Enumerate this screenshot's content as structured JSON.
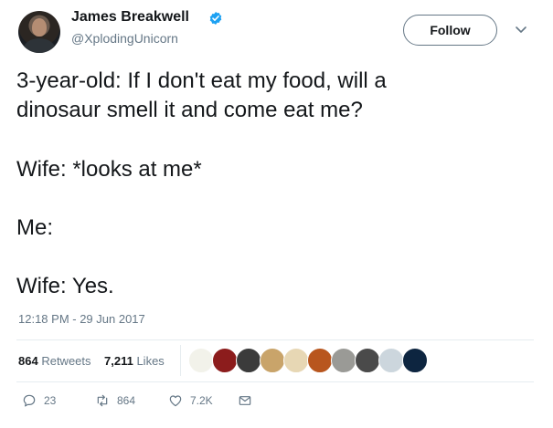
{
  "author": {
    "name": "James Breakwell",
    "handle": "@XplodingUnicorn"
  },
  "follow_label": "Follow",
  "tweet_lines": [
    "3-year-old: If I don't eat my food, will a",
    "dinosaur smell it and come eat me?",
    "Wife: *looks at me*",
    "Me:",
    "Wife: Yes."
  ],
  "timestamp": "12:18 PM - 29 Jun 2017",
  "stats": {
    "retweets_count": "864",
    "retweets_label": "Retweets",
    "likes_count": "7,211",
    "likes_label": "Likes"
  },
  "likers": [
    {
      "icon": "avatar-sketch",
      "color": "#f2f2ea"
    },
    {
      "icon": "avatar-red-rose",
      "color": "#8c1c1c"
    },
    {
      "icon": "avatar-dark-glasses",
      "color": "#3b3b3b"
    },
    {
      "icon": "avatar-dog",
      "color": "#c9a46a"
    },
    {
      "icon": "avatar-cartoon",
      "color": "#e7d7b4"
    },
    {
      "icon": "avatar-orange-scene",
      "color": "#b8561e"
    },
    {
      "icon": "avatar-gray-animal",
      "color": "#9a9a96"
    },
    {
      "icon": "avatar-dark-landscape",
      "color": "#4a4a4a"
    },
    {
      "icon": "avatar-default-egg",
      "color": "#ccd6dd"
    },
    {
      "icon": "avatar-galaxy",
      "color": "#0d2540"
    }
  ],
  "actions": {
    "reply_count": "23",
    "retweet_count": "864",
    "like_count": "7.2K"
  },
  "colors": {
    "verified_blue": "#1da1f2",
    "secondary_text": "#657786",
    "divider": "#e6ecf0"
  }
}
